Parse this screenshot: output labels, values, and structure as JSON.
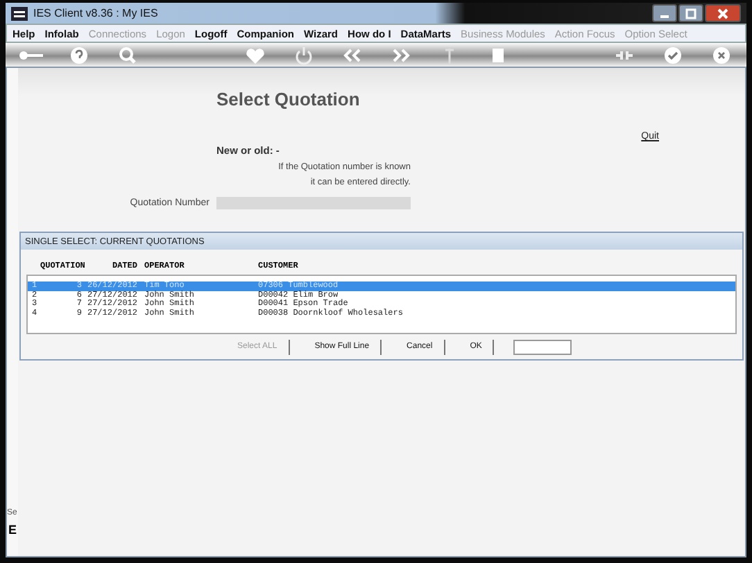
{
  "window": {
    "title": "IES Client v8.36 : My IES"
  },
  "menu": [
    {
      "label": "Help",
      "disabled": false
    },
    {
      "label": "Infolab",
      "disabled": false
    },
    {
      "label": "Connections",
      "disabled": true
    },
    {
      "label": "Logon",
      "disabled": true
    },
    {
      "label": "Logoff",
      "disabled": false
    },
    {
      "label": "Companion",
      "disabled": false
    },
    {
      "label": "Wizard",
      "disabled": false
    },
    {
      "label": "How do I",
      "disabled": false
    },
    {
      "label": "DataMarts",
      "disabled": false
    },
    {
      "label": "Business Modules",
      "disabled": true
    },
    {
      "label": "Action Focus",
      "disabled": true
    },
    {
      "label": "Option Select",
      "disabled": true
    }
  ],
  "form": {
    "title": "Select Quotation",
    "quit": "Quit",
    "new_or_old": "New or old: -",
    "hint": [
      "If the Quotation number is known",
      "it can be entered directly."
    ],
    "field_label": "Quotation Number"
  },
  "dialog": {
    "title": "SINGLE SELECT: CURRENT QUOTATIONS",
    "columns": [
      "",
      "QUOTATION",
      "DATED",
      "OPERATOR",
      "CUSTOMER"
    ],
    "rows": [
      {
        "cells": [
          "1",
          "3",
          "26/12/2012",
          "Tim Tono",
          "07306 Tumblewood"
        ],
        "selected": true
      },
      {
        "cells": [
          "2",
          "6",
          "27/12/2012",
          "John Smith",
          "D00042 Elim Brow"
        ],
        "selected": false
      },
      {
        "cells": [
          "3",
          "7",
          "27/12/2012",
          "John Smith",
          "D00041 Epson Trade"
        ],
        "selected": false
      },
      {
        "cells": [
          "4",
          "9",
          "27/12/2012",
          "John Smith",
          "D00038 Doornkloof Wholesalers"
        ],
        "selected": false
      }
    ],
    "buttons": [
      {
        "label": "Select ALL",
        "disabled": true
      },
      {
        "label": "Show Full Line",
        "disabled": false
      },
      {
        "label": "Cancel",
        "disabled": false
      },
      {
        "label": "OK",
        "disabled": false
      }
    ]
  },
  "side_texts": [
    "Se",
    "E"
  ]
}
